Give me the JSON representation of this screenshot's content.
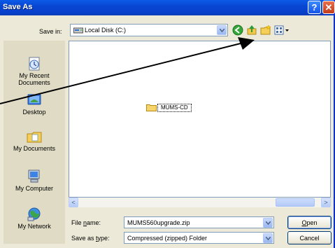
{
  "window": {
    "title": "Save As"
  },
  "savein": {
    "label": "Save in:",
    "value": "Local Disk (C:)"
  },
  "toolbar": {
    "icons": [
      "back-icon",
      "up-folder-icon",
      "new-folder-icon",
      "views-menu-icon"
    ]
  },
  "places": [
    {
      "id": "recent",
      "label_line1": "My Recent",
      "label_line2": "Documents",
      "icon": "recent-documents-icon"
    },
    {
      "id": "desktop",
      "label_line1": "Desktop",
      "label_line2": "",
      "icon": "desktop-icon"
    },
    {
      "id": "mydocs",
      "label_line1": "My Documents",
      "label_line2": "",
      "icon": "my-documents-icon"
    },
    {
      "id": "mycomputer",
      "label_line1": "My Computer",
      "label_line2": "",
      "icon": "my-computer-icon"
    },
    {
      "id": "network",
      "label_line1": "My Network",
      "label_line2": "",
      "icon": "my-network-icon"
    }
  ],
  "files": [
    {
      "name": "MUMS-CD",
      "type": "folder"
    }
  ],
  "filename": {
    "label_pre": "File ",
    "label_key": "n",
    "label_post": "ame:",
    "value": "MUMS560upgrade.zip"
  },
  "filetype": {
    "label_pre": "Save as ",
    "label_key": "t",
    "label_post": "ype:",
    "value": "Compressed (zipped) Folder"
  },
  "buttons": {
    "open": {
      "key": "O",
      "rest": "pen"
    },
    "cancel": "Cancel"
  },
  "colors": {
    "title_bar": "#0846d1",
    "dialog_bg": "#ece9d8",
    "places_bg": "#dfdbc4",
    "field_border": "#7f9db9"
  }
}
